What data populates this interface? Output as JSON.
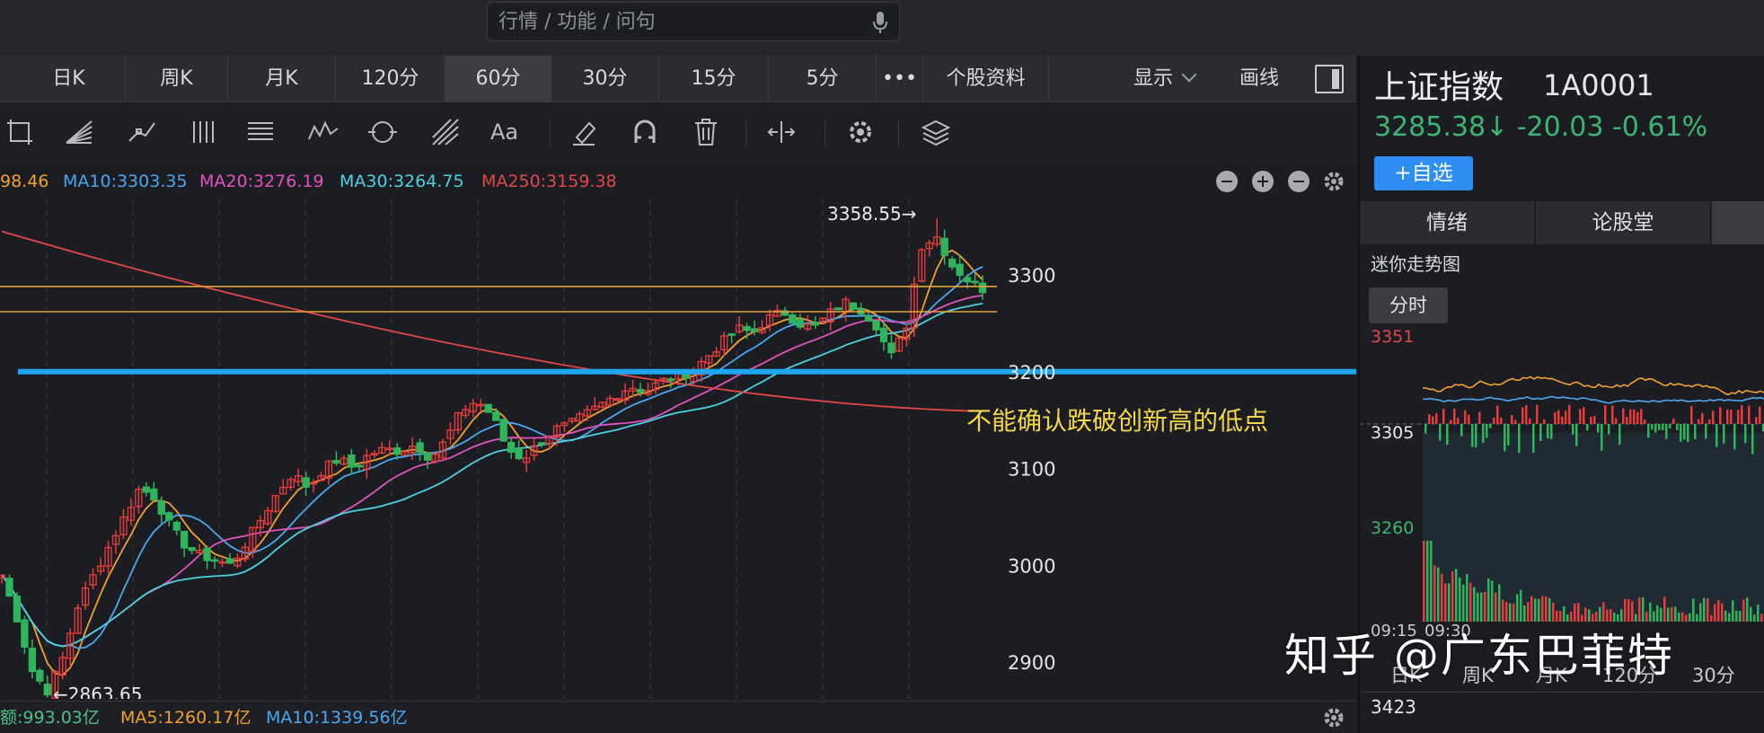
{
  "search": {
    "placeholder": "行情 / 功能 / 问句"
  },
  "periods": [
    {
      "label": "日K",
      "active": false
    },
    {
      "label": "周K",
      "active": false
    },
    {
      "label": "月K",
      "active": false
    },
    {
      "label": "120分",
      "active": false
    },
    {
      "label": "60分",
      "active": true
    },
    {
      "label": "30分",
      "active": false
    },
    {
      "label": "15分",
      "active": false
    },
    {
      "label": "5分",
      "active": false
    },
    {
      "label": "•••",
      "active": false
    },
    {
      "label": "个股资料",
      "active": false
    }
  ],
  "toolbar": {
    "display_label": "显示",
    "draw_label": "画线",
    "text_tool_label": "Aa"
  },
  "ma_legend": {
    "ma5": "98.46",
    "ma10": "MA10:3303.35",
    "ma20": "MA20:3276.19",
    "ma30": "MA30:3264.75",
    "ma250": "MA250:3159.38"
  },
  "colors": {
    "ma5": "#f0a030",
    "ma10": "#4aa7f0",
    "ma20": "#e052c0",
    "ma30": "#4cd0e0",
    "ma250": "#e04848",
    "up": "#e83c3c",
    "down": "#2fb55c",
    "hline": "#e3a33a",
    "support": "#1ea7f0",
    "annotation": "#f3d64a"
  },
  "chart_data": {
    "type": "candlestick",
    "y_ticks": [
      "3300",
      "3200",
      "3100",
      "3000",
      "2900"
    ],
    "y_ticks_values": [
      3300,
      3200,
      3100,
      3000,
      2900
    ],
    "ylim": [
      2862,
      3378
    ],
    "high_label": "3358.55→",
    "low_label": "←2863.65",
    "high_value": 3358.55,
    "low_value": 2863.65,
    "annotation": "不能确认跌破创新高的低点",
    "horizontal_lines": [
      3288,
      3262
    ],
    "support_line": 3200,
    "ma250_start": 3345,
    "ma250_end": 3159.38,
    "close_path": [
      2990,
      2945,
      2890,
      2870,
      2905,
      2960,
      2990,
      3020,
      3050,
      3080,
      3070,
      3040,
      3020,
      3010,
      3005,
      3000,
      3025,
      3050,
      3075,
      3095,
      3080,
      3100,
      3110,
      3100,
      3115,
      3120,
      3118,
      3125,
      3110,
      3130,
      3160,
      3170,
      3155,
      3120,
      3110,
      3125,
      3140,
      3145,
      3155,
      3165,
      3175,
      3185,
      3180,
      3190,
      3195,
      3200,
      3215,
      3230,
      3245,
      3240,
      3255,
      3262,
      3250,
      3245,
      3260,
      3272,
      3265,
      3250,
      3215,
      3245,
      3330,
      3340,
      3310,
      3295,
      3285.38
    ]
  },
  "right_panel": {
    "name": "上证指数",
    "code": "1A0001",
    "price": "3285.38↓ -20.03 -0.61%",
    "add_watch": "+自选",
    "tabs": [
      "情绪",
      "论股堂",
      ""
    ],
    "mini_title": "迷你走势图",
    "fenshi": "分时",
    "mini_labels": {
      "top": "3351",
      "mid": "3305",
      "low": "3260",
      "time1": "09:15",
      "time2": "09:30",
      "bottom": "3423"
    },
    "mini_periods": [
      "日K",
      "周K",
      "月K",
      "120分",
      "30分"
    ]
  },
  "volume_legend": {
    "amount": "额:993.03亿",
    "ma5": "MA5:1260.17亿",
    "ma10": "MA10:1339.56亿"
  },
  "watermark": "知乎 @广东巴菲特"
}
